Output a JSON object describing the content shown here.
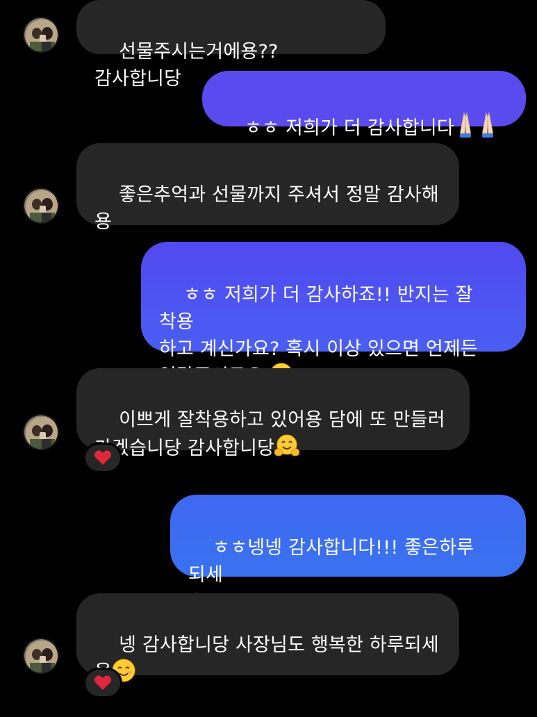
{
  "colors": {
    "background": "#000000",
    "incoming_bubble": "#262626",
    "outgoing_top": "#5b4bee",
    "outgoing_bottom": "#3f6ff2",
    "text": "#ffffff",
    "heart": "#e0263b"
  },
  "messages": [
    {
      "sender": "them",
      "text": "선물주시는거에용?? 감사합니당",
      "emoji": ""
    },
    {
      "sender": "me",
      "text": "ㅎㅎ 저희가 더 감사합니다",
      "emoji": "folded-hands-x2"
    },
    {
      "sender": "them",
      "text": "좋은추억과 선물까지 주셔서 정말 감사해\n용",
      "emoji": ""
    },
    {
      "sender": "me",
      "text": "ㅎㅎ 저희가 더 감사하죠!! 반지는 잘 착용\n하고 계신가요? 혹시 이상 있으면 언제든\n연락주시구요",
      "emoji": "grinning-face"
    },
    {
      "sender": "them",
      "text": "이쁘게 잘착용하고 있어용 담에 또 만들러\n가겠습니당 감사합니당",
      "emoji": "hugging-face",
      "reaction": "heart"
    },
    {
      "sender": "me",
      "text": "ㅎㅎ넹넹 감사합니다!!! 좋은하루 되세\n요!!!:)",
      "emoji": ""
    },
    {
      "sender": "them",
      "text": "넹 감사합니당 사장님도 행복한 하루되세\n용",
      "emoji": "smiling-face",
      "reaction": "heart"
    }
  ]
}
